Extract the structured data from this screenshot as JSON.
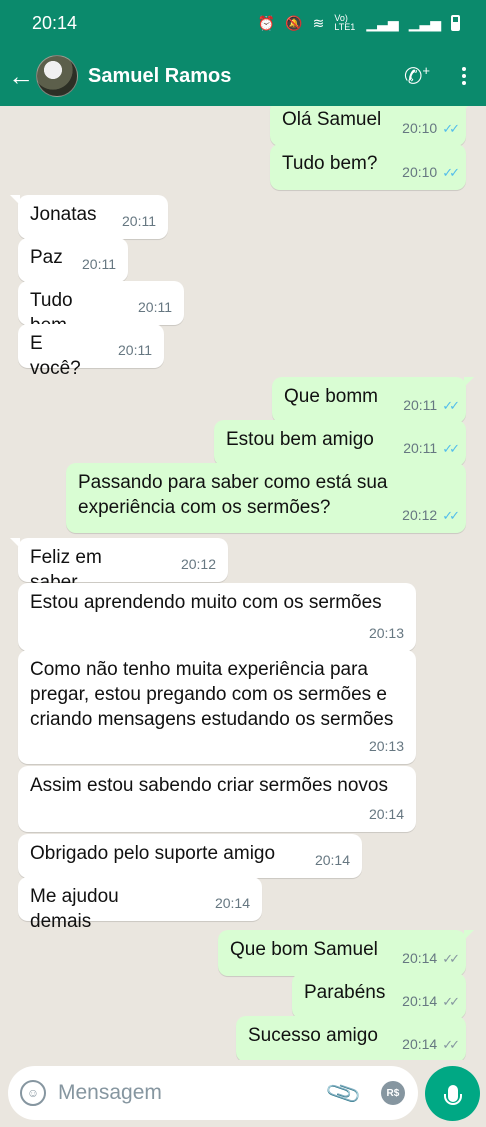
{
  "status_bar": {
    "time": "20:14",
    "network": "Vo) LTE1"
  },
  "header": {
    "back_icon": "arrow-left-icon",
    "contact_name": "Samuel Ramos"
  },
  "messages": [
    {
      "dir": "out",
      "text": "Olá Samuel",
      "time": "20:10",
      "read": true
    },
    {
      "dir": "out",
      "text": "Tudo bem?",
      "time": "20:10",
      "read": true
    },
    {
      "dir": "in",
      "text": "Jonatas",
      "time": "20:11"
    },
    {
      "dir": "in",
      "text": "Paz",
      "time": "20:11"
    },
    {
      "dir": "in",
      "text": "Tudo bem",
      "time": "20:11"
    },
    {
      "dir": "in",
      "text": "E você?",
      "time": "20:11"
    },
    {
      "dir": "out",
      "text": "Que bomm",
      "time": "20:11",
      "read": true
    },
    {
      "dir": "out",
      "text": "Estou bem amigo",
      "time": "20:11",
      "read": true
    },
    {
      "dir": "out",
      "text": "Passando para saber como está sua experiência com os sermões?",
      "time": "20:12",
      "read": true
    },
    {
      "dir": "in",
      "text": "Feliz em saber",
      "time": "20:12"
    },
    {
      "dir": "in",
      "text": "Estou aprendendo muito com os sermões",
      "time": "20:13"
    },
    {
      "dir": "in",
      "text": "Como não tenho muita experiência para pregar, estou pregando com os sermões e criando mensagens estudando os sermões",
      "time": "20:13"
    },
    {
      "dir": "in",
      "text": "Assim estou sabendo criar sermões novos",
      "time": "20:14"
    },
    {
      "dir": "in",
      "text": "Obrigado pelo suporte amigo",
      "time": "20:14"
    },
    {
      "dir": "in",
      "text": "Me ajudou demais",
      "time": "20:14"
    },
    {
      "dir": "out",
      "text": "Que bom Samuel",
      "time": "20:14",
      "read": false
    },
    {
      "dir": "out",
      "text": "Parabéns",
      "time": "20:14",
      "read": false
    },
    {
      "dir": "out",
      "text": "Sucesso amigo",
      "time": "20:14",
      "read": false
    }
  ],
  "composer": {
    "placeholder": "Mensagem",
    "payment_label": "R$"
  },
  "colors": {
    "header": "#0b8a6c",
    "outgoing_bubble": "#d9fdd3",
    "incoming_bubble": "#ffffff",
    "read_ticks": "#53bdeb",
    "mic_button": "#00a884"
  }
}
